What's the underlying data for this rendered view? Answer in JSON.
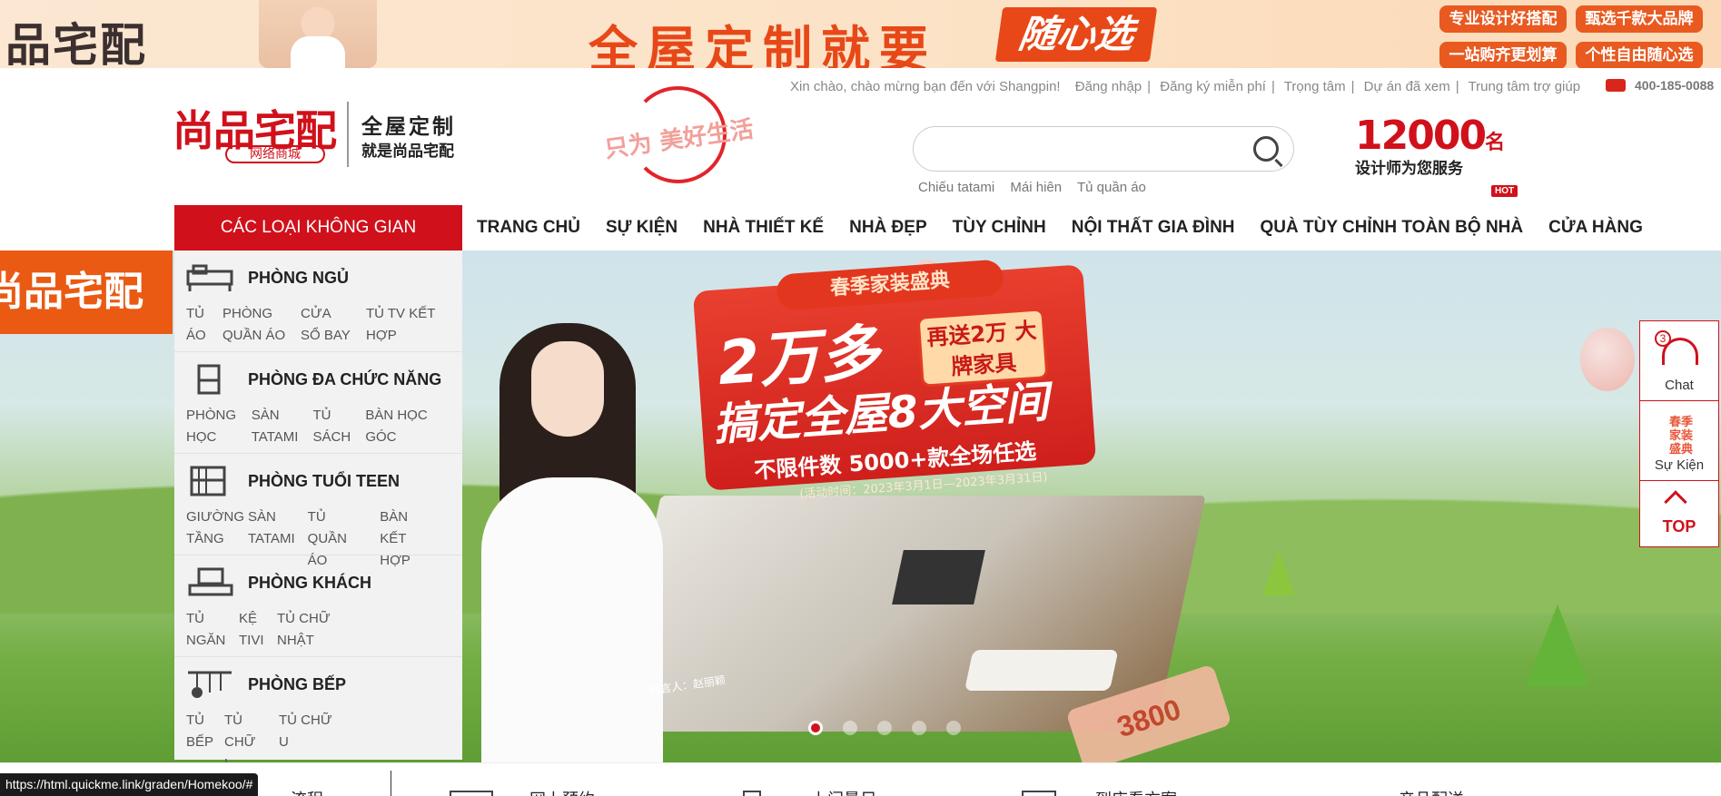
{
  "promo": {
    "logo": "品宅配",
    "title": "全屋定制就要",
    "highlight": "随心选",
    "tags": [
      "专业设计好搭配",
      "甄选千款大品牌",
      "一站购齐更划算",
      "个性自由随心选"
    ]
  },
  "header": {
    "greeting": "Xin chào, chào mừng bạn đến với Shangpin!",
    "login": "Đăng nhập",
    "register": "Đăng ký miễn phí",
    "center": "Trọng tâm",
    "viewed": "Dự án đã xem",
    "help": "Trung tâm trợ giúp",
    "phone": "400-185-0088",
    "logo_main": "尚品宅配",
    "logo_sub": "网络商城",
    "slogan_1": "全屋定制",
    "slogan_2": "就是尚品宅配",
    "stamp_text": "只为 美好生活",
    "search_placeholder": "",
    "hot_words": [
      "Chiếu tatami",
      "Mái hiên",
      "Tủ quần áo"
    ],
    "designers_num": "12000",
    "designers_unit": "名",
    "designers_sub": "设计师为您服务"
  },
  "nav": {
    "category_label": "CÁC LOẠI KHÔNG GIAN",
    "items": [
      "TRANG CHỦ",
      "SỰ KIỆN",
      "NHÀ THIẾT KẾ",
      "NHÀ ĐẸP",
      "TÙY CHỈNH",
      "NỘI THẤT GIA ĐÌNH",
      "QUÀ TÙY CHỈNH TOÀN BỘ NHÀ",
      "CỬA HÀNG"
    ],
    "hot_badge": "HOT"
  },
  "categories": [
    {
      "title": "PHÒNG NGỦ",
      "icon": "bed-icon",
      "items": [
        "TỦ ÁO",
        "PHÒNG QUẦN ÁO",
        "CỬA SỔ BAY",
        "TỦ TV KẾT HỢP"
      ]
    },
    {
      "title": "PHÒNG ĐA CHỨC NĂNG",
      "icon": "chair-icon",
      "items": [
        "PHÒNG HỌC",
        "SÀN TATAMI",
        "TỦ SÁCH",
        "BÀN HỌC GÓC"
      ]
    },
    {
      "title": "PHÒNG TUỔI TEEN",
      "icon": "bunk-bed-icon",
      "items": [
        "GIƯỜNG TẦNG",
        "SÀN TATAMI",
        "TỦ QUẦN ÁO",
        "BÀN KẾT HỢP"
      ]
    },
    {
      "title": "PHÒNG KHÁCH",
      "icon": "tv-cabinet-icon",
      "items": [
        "TỦ NGĂN",
        "KỆ TIVI",
        "TỦ CHỮ NHẬT"
      ]
    },
    {
      "title": "PHÒNG BẾP",
      "icon": "kitchen-utensils-icon",
      "items": [
        "TỦ BẾP",
        "TỦ CHỮ L",
        "TỦ CHỮ U"
      ]
    }
  ],
  "hero": {
    "left_logo": "尚品宅配",
    "ribbon_top": "春季家装盛典",
    "big_1": "2万多",
    "badge": "再送2万 大牌家具",
    "big_2": "搞定全屋8大空间",
    "line_1": "不限件数 5000+款全场任选",
    "line_2": "(活动时间：2023年3月1日—2023年3月31日)",
    "signature": "代言人：赵丽颖",
    "tag": "3800",
    "slide_count": 5,
    "active_slide": 1
  },
  "side": {
    "chat_label": "Chat",
    "chat_count": "3",
    "event_icon_text": "春季 家装盛典",
    "event_label": "Sự Kiện",
    "top_label": "TOP"
  },
  "bottom": {
    "items": [
      "流程",
      "网上预约",
      "上门量尺",
      "到店看方案",
      "产品配送"
    ]
  },
  "status_url": "https://html.quickme.link/graden/Homekoo/#"
}
